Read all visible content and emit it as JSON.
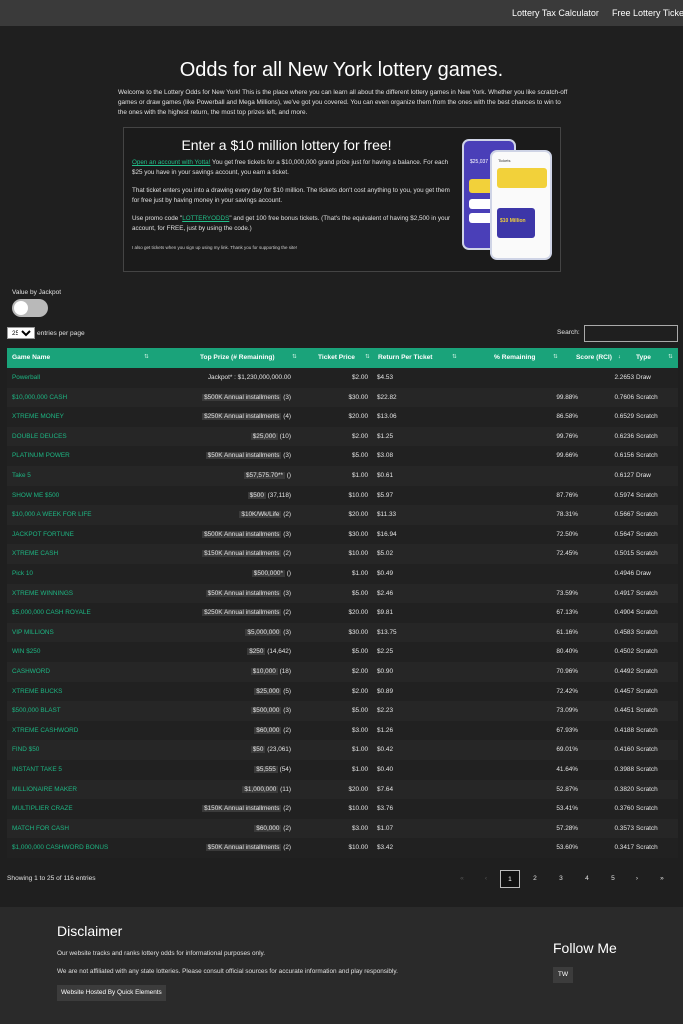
{
  "nav": {
    "links": [
      "Lottery Tax Calculator",
      "Free Lottery Tickets"
    ]
  },
  "page": {
    "title": "Odds for all New York lottery games.",
    "intro": "Welcome to the Lottery Odds for New York! This is the place where you can learn all about the different lottery games in New York. Whether you like scratch-off games or draw games (like Powerball and Mega Millions), we've got you covered. You can even organize them from the ones with the best chances to win to the ones with the highest return, the most top prizes left, and more."
  },
  "promo": {
    "title": "Enter a $10 million lottery for free!",
    "p1_link": "Open an account with Yotta!",
    "p1_text": " You get free tickets for a $10,000,000 grand prize just for having a balance. For each $25 you have in your savings account, you earn a ticket.",
    "p2": "That ticket enters you into a drawing every day for $10 million. The tickets don't cost anything to you, you get them for free just by having money in your savings account.",
    "p3_a": "Use promo code \"",
    "p3_code": "LOTTERYODDS",
    "p3_b": "\" and get 100 free bonus tickets. (That's the equivalent of having $2,500 in your account, for FREE, just by using the code.)",
    "small": "I also get tickets when you sign up using my link. Thank you for supporting the site!",
    "phone1_amount": "$25,037",
    "phone2_header": "Tickets",
    "phone2_prize": "$10 Million"
  },
  "controls": {
    "toggle_label": "Value by Jackpot",
    "entries_value": "25",
    "entries_suffix": "entries per page",
    "search_label": "Search:"
  },
  "table": {
    "headers": [
      "Game Name",
      "Top Prize (# Remaining)",
      "Ticket Price",
      "Return Per Ticket",
      "% Remaining",
      "Score (RCI)",
      "Type"
    ],
    "rows": [
      {
        "name": "Powerball",
        "prize": "Jackpot* : $1,230,000,000.00",
        "rem": "",
        "price": "$2.00",
        "ret": "$4.53",
        "pct": "",
        "score": "2.2653",
        "type": "Draw"
      },
      {
        "name": "$10,000,000 CASH",
        "prize": "$500K Annual installments",
        "rem": "(3)",
        "price": "$30.00",
        "ret": "$22.82",
        "pct": "99.88%",
        "score": "0.7606",
        "type": "Scratch"
      },
      {
        "name": "XTREME MONEY",
        "prize": "$250K Annual installments",
        "rem": "(4)",
        "price": "$20.00",
        "ret": "$13.06",
        "pct": "86.58%",
        "score": "0.6529",
        "type": "Scratch"
      },
      {
        "name": "DOUBLE DEUCES",
        "prize": "$25,000",
        "rem": "(10)",
        "price": "$2.00",
        "ret": "$1.25",
        "pct": "99.76%",
        "score": "0.6236",
        "type": "Scratch"
      },
      {
        "name": "PLATINUM POWER",
        "prize": "$50K Annual installments",
        "rem": "(3)",
        "price": "$5.00",
        "ret": "$3.08",
        "pct": "99.66%",
        "score": "0.6156",
        "type": "Scratch"
      },
      {
        "name": "Take 5",
        "prize": "$57,575.70**",
        "rem": "()",
        "price": "$1.00",
        "ret": "$0.61",
        "pct": "",
        "score": "0.6127",
        "type": "Draw"
      },
      {
        "name": "SHOW ME $500",
        "prize": "$500",
        "rem": "(37,118)",
        "price": "$10.00",
        "ret": "$5.97",
        "pct": "87.76%",
        "score": "0.5974",
        "type": "Scratch"
      },
      {
        "name": "$10,000 A WEEK FOR LIFE",
        "prize": "$10K/Wk/Life",
        "rem": "(2)",
        "price": "$20.00",
        "ret": "$11.33",
        "pct": "78.31%",
        "score": "0.5667",
        "type": "Scratch"
      },
      {
        "name": "JACKPOT FORTUNE",
        "prize": "$500K Annual installments",
        "rem": "(3)",
        "price": "$30.00",
        "ret": "$16.94",
        "pct": "72.50%",
        "score": "0.5647",
        "type": "Scratch"
      },
      {
        "name": "XTREME CASH",
        "prize": "$150K Annual installments",
        "rem": "(2)",
        "price": "$10.00",
        "ret": "$5.02",
        "pct": "72.45%",
        "score": "0.5015",
        "type": "Scratch"
      },
      {
        "name": "Pick 10",
        "prize": "$500,000*",
        "rem": "()",
        "price": "$1.00",
        "ret": "$0.49",
        "pct": "",
        "score": "0.4946",
        "type": "Draw"
      },
      {
        "name": "XTREME WINNINGS",
        "prize": "$50K Annual installments",
        "rem": "(3)",
        "price": "$5.00",
        "ret": "$2.46",
        "pct": "73.59%",
        "score": "0.4917",
        "type": "Scratch"
      },
      {
        "name": "$5,000,000 CASH ROYALE",
        "prize": "$250K Annual installments",
        "rem": "(2)",
        "price": "$20.00",
        "ret": "$9.81",
        "pct": "67.13%",
        "score": "0.4904",
        "type": "Scratch"
      },
      {
        "name": "VIP MILLIONS",
        "prize": "$5,000,000",
        "rem": "(3)",
        "price": "$30.00",
        "ret": "$13.75",
        "pct": "61.16%",
        "score": "0.4583",
        "type": "Scratch"
      },
      {
        "name": "WIN $250",
        "prize": "$250",
        "rem": "(14,642)",
        "price": "$5.00",
        "ret": "$2.25",
        "pct": "80.40%",
        "score": "0.4502",
        "type": "Scratch"
      },
      {
        "name": "CASHWORD",
        "prize": "$10,000",
        "rem": "(18)",
        "price": "$2.00",
        "ret": "$0.90",
        "pct": "70.96%",
        "score": "0.4492",
        "type": "Scratch"
      },
      {
        "name": "XTREME BUCKS",
        "prize": "$25,000",
        "rem": "(5)",
        "price": "$2.00",
        "ret": "$0.89",
        "pct": "72.42%",
        "score": "0.4457",
        "type": "Scratch"
      },
      {
        "name": "$500,000 BLAST",
        "prize": "$500,000",
        "rem": "(3)",
        "price": "$5.00",
        "ret": "$2.23",
        "pct": "73.09%",
        "score": "0.4451",
        "type": "Scratch"
      },
      {
        "name": "XTREME CASHWORD",
        "prize": "$60,000",
        "rem": "(2)",
        "price": "$3.00",
        "ret": "$1.26",
        "pct": "67.93%",
        "score": "0.4188",
        "type": "Scratch"
      },
      {
        "name": "FIND $50",
        "prize": "$50",
        "rem": "(23,061)",
        "price": "$1.00",
        "ret": "$0.42",
        "pct": "69.01%",
        "score": "0.4160",
        "type": "Scratch"
      },
      {
        "name": "INSTANT TAKE 5",
        "prize": "$5,555",
        "rem": "(54)",
        "price": "$1.00",
        "ret": "$0.40",
        "pct": "41.64%",
        "score": "0.3988",
        "type": "Scratch"
      },
      {
        "name": "MILLIONAIRE MAKER",
        "prize": "$1,000,000",
        "rem": "(11)",
        "price": "$20.00",
        "ret": "$7.64",
        "pct": "52.87%",
        "score": "0.3820",
        "type": "Scratch"
      },
      {
        "name": "MULTIPLIER CRAZE",
        "prize": "$150K Annual installments",
        "rem": "(2)",
        "price": "$10.00",
        "ret": "$3.76",
        "pct": "53.41%",
        "score": "0.3760",
        "type": "Scratch"
      },
      {
        "name": "MATCH FOR CASH",
        "prize": "$60,000",
        "rem": "(2)",
        "price": "$3.00",
        "ret": "$1.07",
        "pct": "57.28%",
        "score": "0.3573",
        "type": "Scratch"
      },
      {
        "name": "$1,000,000 CASHWORD BONUS",
        "prize": "$50K Annual installments",
        "rem": "(2)",
        "price": "$10.00",
        "ret": "$3.42",
        "pct": "53.60%",
        "score": "0.3417",
        "type": "Scratch"
      }
    ]
  },
  "pagination": {
    "showing": "Showing 1 to 25 of 116 entries",
    "first": "«",
    "prev": "‹",
    "pages": [
      "1",
      "2",
      "3",
      "4",
      "5"
    ],
    "next": "›",
    "last": "»"
  },
  "footer": {
    "disclaimer_title": "Disclaimer",
    "line1": "Our website tracks and ranks lottery odds for informational purposes only.",
    "line2": "We are not affiliated with any state lotteries. Please consult official sources for accurate information and play responsibly.",
    "hosted": "Website Hosted By Quick Elements",
    "follow_title": "Follow Me",
    "tw": "TW"
  }
}
